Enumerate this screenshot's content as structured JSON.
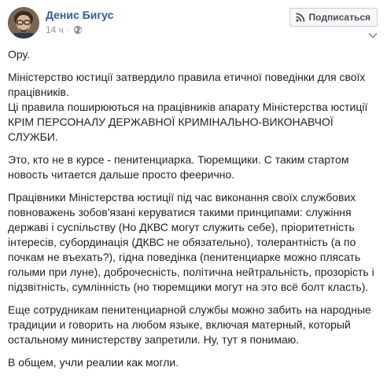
{
  "post": {
    "author": "Денис Бигус",
    "time": "14 ч",
    "subscribe_label": "Подписаться",
    "paragraphs": [
      "Ору.",
      "Міністерство юстиції затвердило правила етичної поведінки для своїх працівників.\nЦі правила поширюються на працівників апарату Міністерства юстиції КРІМ ПЕРСОНАЛУ ДЕРЖАВНОЇ КРИМІНАЛЬНО-ВИКОНАВЧОЇ СЛУЖБИ.",
      "Это, кто не в курсе - пенитенциарка. Тюремщики. С таким стартом новость читается дальше просто феерично.",
      "Працівники Міністерства юстиції під час виконання своїх службових повноважень зобов'язані керуватися такими принципами: служіння державі і суспільству (Но ДКВС могут служить себе), пріоритетність інтересів, субординація (ДКВС не обязательно), толерантність (а по почкам не въехать?), гідна поведінка (пенитенциарке можно плясать голыми при луне), доброчесність, політична нейтральність, прозорість і підзвітність, сумлінність (но тюремщики могут на это всё болт класть).",
      "Еще сотрудникам пенитенциарной службы можно забить на народные традиции и говорить на любом языке, включая матерный, который остальному министерству запретили. Ну, тут я понимаю.",
      "В общем, учли реалии как могли."
    ]
  },
  "icons": {
    "avatar": "avatar-photo",
    "privacy": "globe-icon",
    "subscribe": "rss-icon",
    "menu": "chevron-down-icon"
  },
  "colors": {
    "author_link": "#365899",
    "meta_text": "#90949c",
    "body_text": "#1d2129",
    "button_bg": "#f6f7f9",
    "button_border": "#ccd0d5"
  }
}
